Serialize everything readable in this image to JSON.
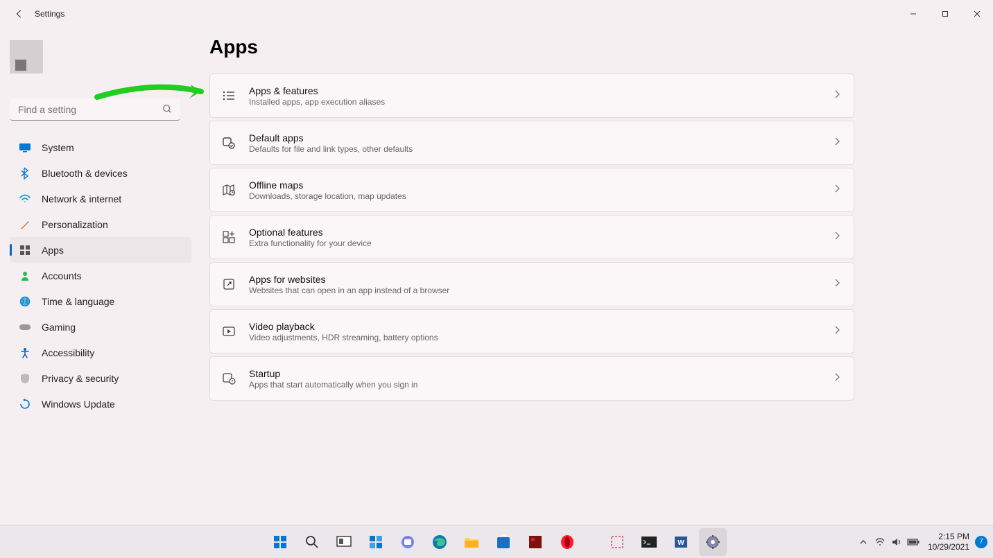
{
  "window": {
    "title": "Settings"
  },
  "search": {
    "placeholder": "Find a setting"
  },
  "nav": [
    {
      "label": "System",
      "color": "#0078d4"
    },
    {
      "label": "Bluetooth & devices",
      "color": "#0078d4"
    },
    {
      "label": "Network & internet",
      "color": "#00a3c4"
    },
    {
      "label": "Personalization",
      "color": "#8b5a3c"
    },
    {
      "label": "Apps",
      "color": "#555",
      "active": true
    },
    {
      "label": "Accounts",
      "color": "#1db954"
    },
    {
      "label": "Time & language",
      "color": "#0078d4"
    },
    {
      "label": "Gaming",
      "color": "#888"
    },
    {
      "label": "Accessibility",
      "color": "#0067c0"
    },
    {
      "label": "Privacy & security",
      "color": "#aaa"
    },
    {
      "label": "Windows Update",
      "color": "#0078d4"
    }
  ],
  "page": {
    "title": "Apps"
  },
  "cards": [
    {
      "title": "Apps & features",
      "sub": "Installed apps, app execution aliases"
    },
    {
      "title": "Default apps",
      "sub": "Defaults for file and link types, other defaults"
    },
    {
      "title": "Offline maps",
      "sub": "Downloads, storage location, map updates"
    },
    {
      "title": "Optional features",
      "sub": "Extra functionality for your device"
    },
    {
      "title": "Apps for websites",
      "sub": "Websites that can open in an app instead of a browser"
    },
    {
      "title": "Video playback",
      "sub": "Video adjustments, HDR streaming, battery options"
    },
    {
      "title": "Startup",
      "sub": "Apps that start automatically when you sign in"
    }
  ],
  "taskbar": {
    "time": "2:15 PM",
    "date": "10/29/2021",
    "badge": "7"
  }
}
